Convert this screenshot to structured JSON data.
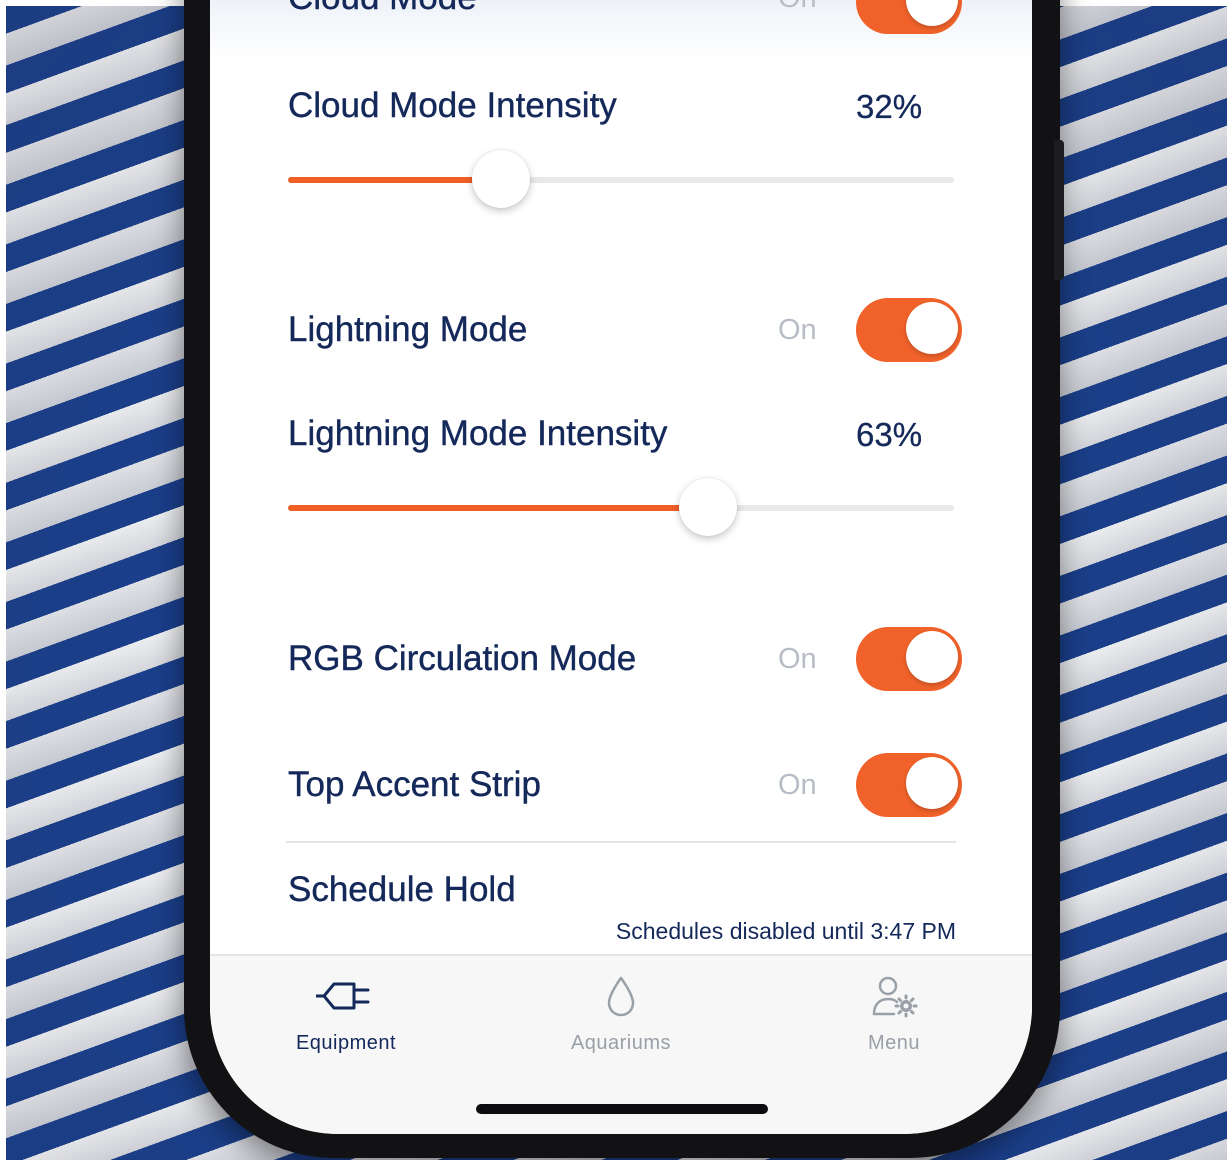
{
  "settings": {
    "cloud_mode": {
      "label": "Cloud Mode",
      "state": "On"
    },
    "cloud_intensity": {
      "label": "Cloud Mode Intensity",
      "value_text": "32%",
      "value": 0.32
    },
    "lightning_mode": {
      "label": "Lightning Mode",
      "state": "On",
      "on": true
    },
    "lightning_intensity": {
      "label": "Lightning Mode Intensity",
      "value_text": "63%",
      "value": 0.63
    },
    "rgb_circulation": {
      "label": "RGB Circulation Mode",
      "state": "On",
      "on": true
    },
    "top_accent": {
      "label": "Top Accent Strip",
      "state": "On",
      "on": true
    },
    "schedule_hold": {
      "label": "Schedule Hold",
      "note": "Schedules disabled until 3:47 PM"
    }
  },
  "tabbar": {
    "tabs": [
      {
        "label": "Equipment",
        "icon": "plug-icon",
        "active": true
      },
      {
        "label": "Aquariums",
        "icon": "droplet-icon",
        "active": false
      },
      {
        "label": "Menu",
        "icon": "user-gear-icon",
        "active": false
      }
    ]
  },
  "colors": {
    "accent": "#ef5f26",
    "text_primary": "#14295a",
    "text_muted": "#b7bcc6",
    "active_tab": "#14295a",
    "inactive_tab": "#9aa0a8"
  }
}
